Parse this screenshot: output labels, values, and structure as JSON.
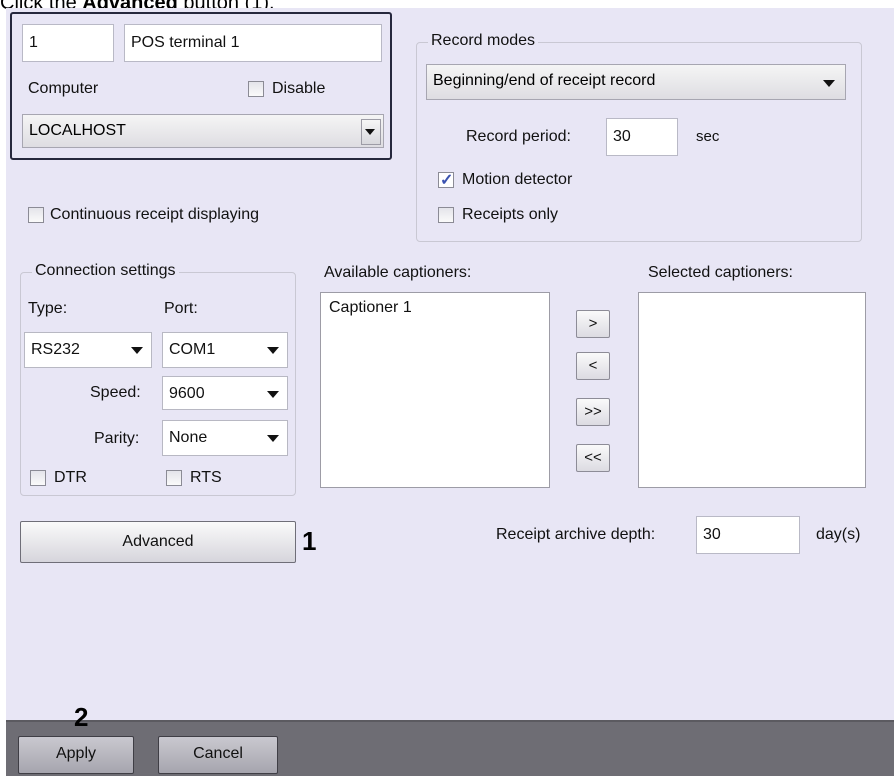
{
  "caption": {
    "prefix": "Click the ",
    "bold": "Advanced",
    "suffix": " button (1)."
  },
  "terminal": {
    "number": "1",
    "name": "POS terminal 1",
    "computer_label": "Computer",
    "disable_label": "Disable",
    "computer_value": "LOCALHOST"
  },
  "continuous_receipt_label": "Continuous receipt displaying",
  "record_modes": {
    "title": "Record modes",
    "mode_value": "Beginning/end of receipt record",
    "record_period_label": "Record period:",
    "record_period_value": "30",
    "record_period_unit": "sec",
    "motion_detector_label": "Motion detector",
    "motion_detector_checked": true,
    "receipts_only_label": "Receipts only"
  },
  "connection": {
    "title": "Connection settings",
    "type_label": "Type:",
    "port_label": "Port:",
    "type_value": "RS232",
    "port_value": "COM1",
    "speed_label": "Speed:",
    "speed_value": "9600",
    "parity_label": "Parity:",
    "parity_value": "None",
    "dtr_label": "DTR",
    "rts_label": "RTS"
  },
  "captioners": {
    "available_label": "Available captioners:",
    "selected_label": "Selected captioners:",
    "available_items": [
      "Captioner 1"
    ],
    "move_right": ">",
    "move_left": "<",
    "move_all_right": ">>",
    "move_all_left": "<<"
  },
  "advanced_button": "Advanced",
  "marker_1": "1",
  "marker_2": "2",
  "archive": {
    "label": "Receipt archive depth:",
    "value": "30",
    "unit": "day(s)"
  },
  "footer": {
    "apply": "Apply",
    "cancel": "Cancel"
  }
}
